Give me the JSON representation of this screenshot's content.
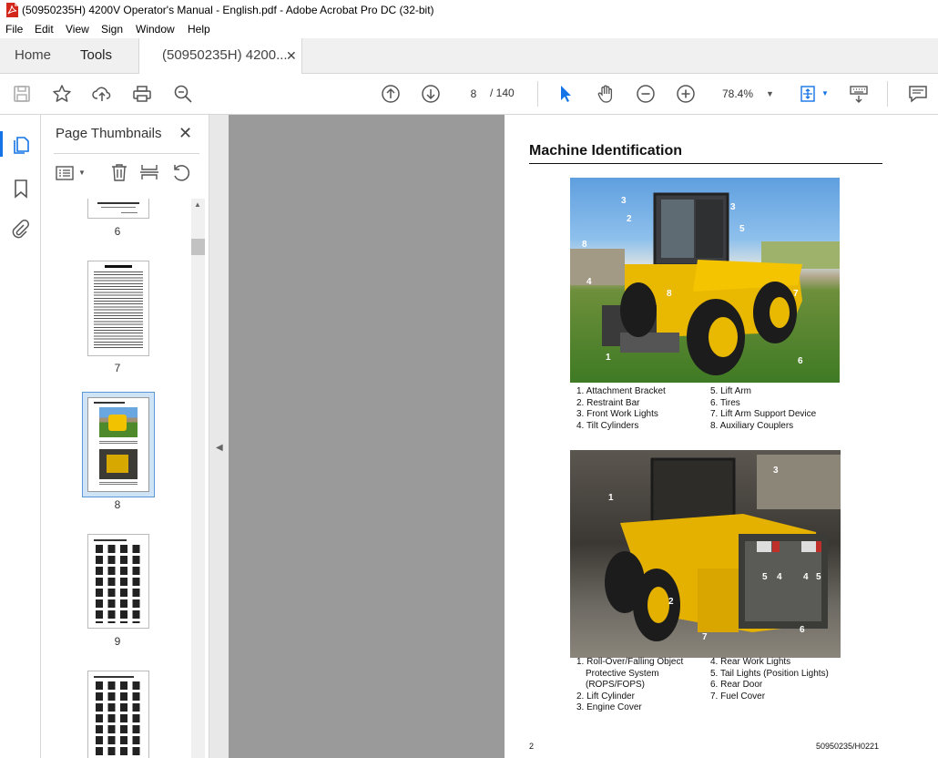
{
  "window": {
    "title": "(50950235H) 4200V Operator's Manual - English.pdf - Adobe Acrobat Pro DC (32-bit)"
  },
  "menu": [
    "File",
    "Edit",
    "View",
    "Sign",
    "Window",
    "Help"
  ],
  "tabs": {
    "home": "Home",
    "tools": "Tools",
    "document": "(50950235H) 4200..."
  },
  "toolbar": {
    "page_current": "8",
    "page_total": "/ 140",
    "zoom": "78.4%",
    "icons": [
      "save-icon",
      "star-icon",
      "upload-icon",
      "print-icon",
      "search-zoom-icon",
      "page-up-icon",
      "page-down-icon",
      "select-arrow-icon",
      "hand-icon",
      "zoom-out-icon",
      "zoom-in-icon",
      "fit-page-icon",
      "keyboard-icon",
      "comment-icon"
    ]
  },
  "sidebar": {
    "title": "Page Thumbnails",
    "thumbnails": [
      {
        "label": "6"
      },
      {
        "label": "7"
      },
      {
        "label": "8",
        "selected": true
      },
      {
        "label": "9"
      },
      {
        "label": ""
      }
    ]
  },
  "colors": {
    "accent": "#1473e6",
    "brand_red": "#d4271b",
    "machine_yellow": "#f2c200",
    "grass": "#4e8a2c",
    "sky": "#6aa6e0"
  },
  "document_page": {
    "heading": "Machine Identification",
    "figure1": {
      "callouts": [
        "1",
        "2",
        "3",
        "3",
        "4",
        "5",
        "6",
        "7",
        "8",
        "8"
      ],
      "legend_left": [
        "1. Attachment Bracket",
        "2. Restraint Bar",
        "3. Front Work Lights",
        "4. Tilt Cylinders"
      ],
      "legend_right": [
        "5. Lift Arm",
        "6. Tires",
        "7. Lift Arm Support Device",
        "8. Auxiliary Couplers"
      ]
    },
    "figure2": {
      "callouts": [
        "1",
        "2",
        "3",
        "4",
        "4",
        "5",
        "5",
        "6",
        "7"
      ],
      "legend_left": [
        "1. Roll-Over/Falling Object",
        "Protective System",
        "(ROPS/FOPS)",
        "2. Lift Cylinder",
        "3. Engine Cover"
      ],
      "legend_right": [
        "4. Rear Work Lights",
        "5. Tail Lights (Position Lights)",
        "6. Rear Door",
        "7. Fuel Cover"
      ]
    },
    "page_number": "2",
    "doc_code": "50950235/H0221"
  }
}
